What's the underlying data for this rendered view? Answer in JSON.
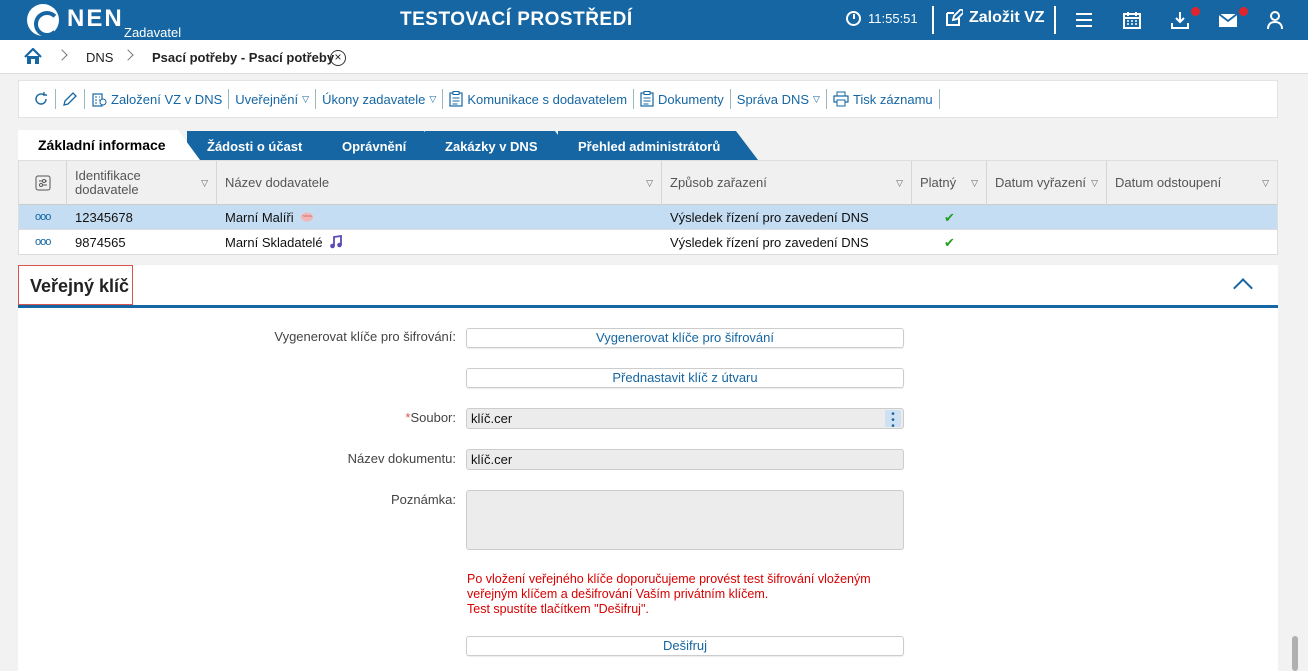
{
  "topbar": {
    "brand": "NEN",
    "brand_sub": "Zadavatel",
    "env_title": "TESTOVACÍ PROSTŘEDÍ",
    "clock": "11:55:51",
    "create_vz": "Založit VZ",
    "icons": [
      "clock-icon",
      "edit-icon",
      "menu-icon",
      "calendar-icon",
      "download-icon",
      "mail-icon",
      "user-icon"
    ],
    "accent": "#1566a3",
    "badge_color": "#e0242b"
  },
  "breadcrumb": {
    "items": [
      "DNS",
      "Psací potřeby - Psací potřeby"
    ],
    "close": "×"
  },
  "toolbar": {
    "items": [
      {
        "label": "",
        "icon": "refresh-icon"
      },
      {
        "label": "",
        "icon": "pencil-icon"
      },
      {
        "label": "Založení VZ v DNS",
        "icon": "building-icon"
      },
      {
        "label": "Uveřejnění",
        "dropdown": true
      },
      {
        "label": "Úkony zadavatele",
        "dropdown": true
      },
      {
        "label": "Komunikace s dodavatelem",
        "icon": "document-icon"
      },
      {
        "label": "Dokumenty",
        "icon": "document-icon"
      },
      {
        "label": "Správa DNS",
        "dropdown": true
      },
      {
        "label": "Tisk záznamu",
        "icon": "printer-icon"
      }
    ],
    "dropdown_marker": "▽"
  },
  "tabs": [
    {
      "label": "Základní informace",
      "active": true
    },
    {
      "label": "Žádosti o účast"
    },
    {
      "label": "Oprávnění"
    },
    {
      "label": "Zakázky v DNS"
    },
    {
      "label": "Přehled administrátorů"
    }
  ],
  "grid": {
    "columns": [
      "Identifikace dodavatele",
      "Název dodavatele",
      "Způsob zařazení",
      "Platný",
      "Datum vyřazení",
      "Datum odstoupení"
    ],
    "sort_marker": "▽",
    "rows": [
      {
        "actions": "ooo",
        "id": "12345678",
        "name": "Marní Malíři",
        "name_icon": "brain-icon",
        "method": "Výsledek řízení pro zavedení DNS",
        "valid": "✔",
        "removed": "",
        "withdrawn": "",
        "selected": true
      },
      {
        "actions": "ooo",
        "id": "9874565",
        "name": "Marní Skladatelé",
        "name_icon": "music-note-icon",
        "method": "Výsledek řízení pro zavedení DNS",
        "valid": "✔",
        "removed": "",
        "withdrawn": "",
        "selected": false
      }
    ]
  },
  "section": {
    "title": "Veřejný klíč",
    "generate_label": "Vygenerovat klíče pro šifrování:",
    "generate_button": "Vygenerovat klíče pro šifrování",
    "preset_button": "Přednastavit klíč z útvaru",
    "file_label": "Soubor:",
    "file_required": "*",
    "file_value": "klíč.cer",
    "docname_label": "Název dokumentu:",
    "docname_value": "klíč.cer",
    "note_label": "Poznámka:",
    "note_value": "",
    "warning_lines": [
      "Po vložení veřejného klíče doporučujeme provést test šifrování vloženým",
      "veřejným klíčem a dešifrování Vaším privátním klíčem.",
      "Test spustíte tlačítkem \"Dešifruj\"."
    ],
    "decrypt_button": "Dešifruj"
  }
}
